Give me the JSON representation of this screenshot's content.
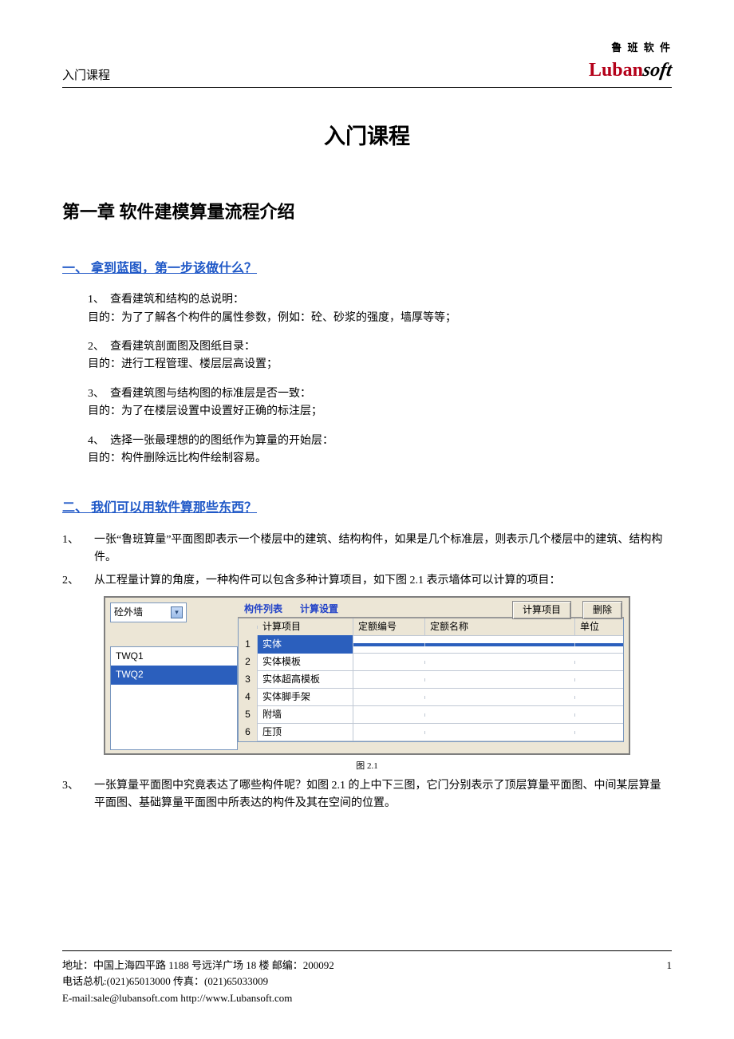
{
  "header": {
    "left": "入门课程",
    "logo_cn": "鲁 班 软 件",
    "logo_red": "Luban",
    "logo_black": "soft"
  },
  "title": "入门课程",
  "chapter": "第一章    软件建模算量流程介绍",
  "section1": {
    "heading": "一、 拿到蓝图，第一步该做什么？",
    "items": [
      {
        "num": "1、",
        "title": "查看建筑和结构的总说明：",
        "purpose": "目的：为了了解各个构件的属性参数，例如：砼、砂浆的强度，墙厚等等；"
      },
      {
        "num": "2、",
        "title": "查看建筑剖面图及图纸目录：",
        "purpose": "目的：进行工程管理、楼层层高设置；"
      },
      {
        "num": "3、",
        "title": "查看建筑图与结构图的标准层是否一致：",
        "purpose": "目的：为了在楼层设置中设置好正确的标注层；"
      },
      {
        "num": "4、",
        "title": "选择一张最理想的的图纸作为算量的开始层：",
        "purpose": "目的：构件删除远比构件绘制容易。"
      }
    ]
  },
  "section2": {
    "heading": "二、 我们可以用软件算那些东西？",
    "items": [
      {
        "num": "1、",
        "text": "一张“鲁班算量”平面图即表示一个楼层中的建筑、结构构件，如果是几个标准层，则表示几个楼层中的建筑、结构构件。"
      },
      {
        "num": "2、",
        "text": "从工程量计算的角度，一种构件可以包含多种计算项目，如下图 2.1 表示墙体可以计算的项目："
      },
      {
        "num": "3、",
        "text": "一张算量平面图中究竟表达了哪些构件呢？如图 2.1 的上中下三图，它门分别表示了顶层算量平面图、中间某层算量平面图、基础算量平面图中所表达的构件及其在空间的位置。"
      }
    ]
  },
  "shot": {
    "combo_value": "砼外墙",
    "tab1": "构件列表",
    "tab2": "计算设置",
    "btn1": "计算项目",
    "btn2": "删除",
    "list": [
      "TWQ1",
      "TWQ2"
    ],
    "list_selected_index": 1,
    "cols": [
      "",
      "计算项目",
      "定额编号",
      "定额名称",
      "单位"
    ],
    "rows": [
      {
        "n": "1",
        "proj": "实体",
        "sel": true
      },
      {
        "n": "2",
        "proj": "实体模板"
      },
      {
        "n": "3",
        "proj": "实体超高模板"
      },
      {
        "n": "4",
        "proj": "实体脚手架"
      },
      {
        "n": "5",
        "proj": "附墙"
      },
      {
        "n": "6",
        "proj": "压顶"
      }
    ],
    "caption": "图 2.1"
  },
  "footer": {
    "addr": "地址：中国上海四平路 1188 号远洋广场 18 楼 邮编：200092",
    "tel": "电话总机:(021)65013000        传真：(021)65033009",
    "mail": "E-mail:sale@lubansoft.com     http://www.Lubansoft.com",
    "page": "1"
  }
}
